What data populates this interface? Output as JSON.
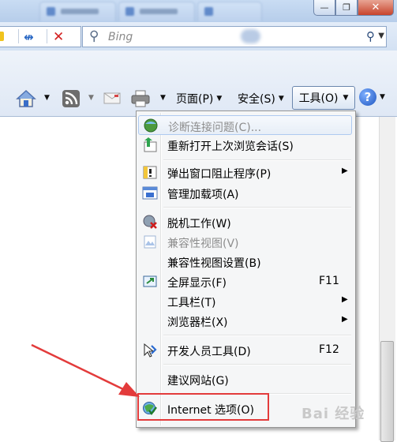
{
  "window": {
    "minimize_label": "—",
    "maximize_label": "❐",
    "close_label": "✕"
  },
  "search": {
    "placeholder": "Bing"
  },
  "toolbar": {
    "page_label": "页面(P)",
    "safety_label": "安全(S)",
    "tools_label": "工具(O)",
    "help_label": "?"
  },
  "menu": {
    "items": [
      {
        "label": "诊断连接问题(C)...",
        "shortcut": "",
        "icon": "diagnose-icon",
        "disabled": true,
        "submenu": false
      },
      {
        "label": "重新打开上次浏览会话(S)",
        "shortcut": "",
        "icon": "reopen-session-icon",
        "disabled": false,
        "submenu": false
      },
      {
        "label": "弹出窗口阻止程序(P)",
        "shortcut": "",
        "icon": "popup-blocker-icon",
        "disabled": false,
        "submenu": true
      },
      {
        "label": "管理加载项(A)",
        "shortcut": "",
        "icon": "manage-addons-icon",
        "disabled": false,
        "submenu": false
      },
      {
        "label": "脱机工作(W)",
        "shortcut": "",
        "icon": "work-offline-icon",
        "disabled": false,
        "submenu": false
      },
      {
        "label": "兼容性视图(V)",
        "shortcut": "",
        "icon": "compat-view-icon",
        "disabled": true,
        "submenu": false
      },
      {
        "label": "兼容性视图设置(B)",
        "shortcut": "",
        "icon": "",
        "disabled": false,
        "submenu": false
      },
      {
        "label": "全屏显示(F)",
        "shortcut": "F11",
        "icon": "fullscreen-icon",
        "disabled": false,
        "submenu": false
      },
      {
        "label": "工具栏(T)",
        "shortcut": "",
        "icon": "",
        "disabled": false,
        "submenu": true
      },
      {
        "label": "浏览器栏(X)",
        "shortcut": "",
        "icon": "",
        "disabled": false,
        "submenu": true
      },
      {
        "label": "开发人员工具(D)",
        "shortcut": "F12",
        "icon": "developer-tools-icon",
        "disabled": false,
        "submenu": false
      },
      {
        "label": "建议网站(G)",
        "shortcut": "",
        "icon": "",
        "disabled": false,
        "submenu": false
      },
      {
        "label": "Internet 选项(O)",
        "shortcut": "",
        "icon": "internet-options-icon",
        "disabled": false,
        "submenu": false
      }
    ]
  },
  "watermark": "Bai 经验",
  "colors": {
    "annotation_red": "#e33b3b",
    "menu_background": "#f5f6f7"
  }
}
